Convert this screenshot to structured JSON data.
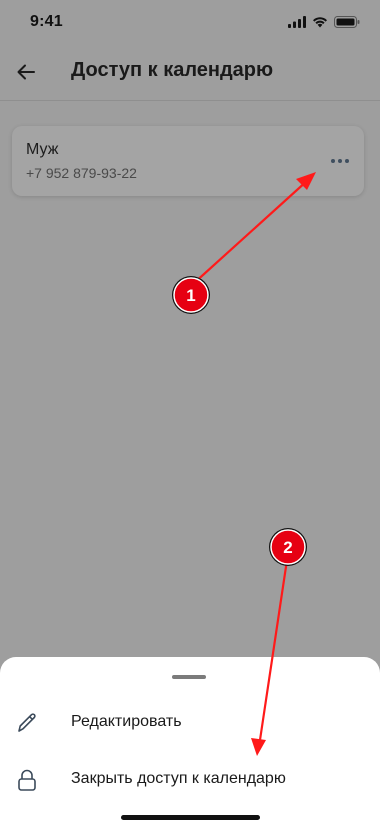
{
  "status_bar": {
    "time": "9:41"
  },
  "header": {
    "title": "Доступ к календарю"
  },
  "contact": {
    "name": "Муж",
    "phone": "+7 952 879-93-22"
  },
  "sheet": {
    "items": [
      {
        "label": "Редактировать",
        "icon": "pencil-icon"
      },
      {
        "label": "Закрыть доступ к календарю",
        "icon": "lock-icon"
      }
    ]
  },
  "annotations": {
    "marker_1": "1",
    "marker_2": "2"
  },
  "colors": {
    "annotation": "#ff1a1a",
    "overlay": "#9e9e9e",
    "sheet": "#ffffff"
  }
}
